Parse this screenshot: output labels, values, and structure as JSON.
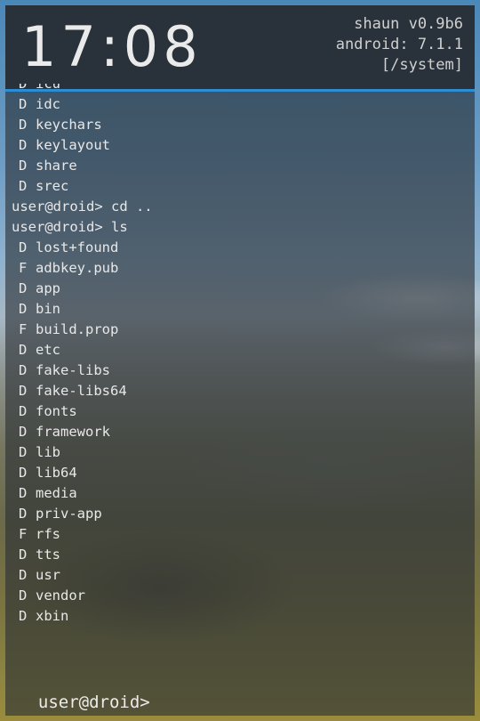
{
  "header": {
    "clock": "17:08",
    "launcher": "shaun v0.9b6",
    "android": "android: 7.1.1",
    "cwd": "[/system]"
  },
  "output": [
    {
      "kind": "entry",
      "type": "D",
      "name": "icu"
    },
    {
      "kind": "entry",
      "type": "D",
      "name": "idc"
    },
    {
      "kind": "entry",
      "type": "D",
      "name": "keychars"
    },
    {
      "kind": "entry",
      "type": "D",
      "name": "keylayout"
    },
    {
      "kind": "entry",
      "type": "D",
      "name": "share"
    },
    {
      "kind": "entry",
      "type": "D",
      "name": "srec"
    },
    {
      "kind": "command",
      "text": "user@droid> cd .."
    },
    {
      "kind": "command",
      "text": "user@droid> ls"
    },
    {
      "kind": "entry",
      "type": "D",
      "name": "lost+found"
    },
    {
      "kind": "entry",
      "type": "F",
      "name": "adbkey.pub"
    },
    {
      "kind": "entry",
      "type": "D",
      "name": "app"
    },
    {
      "kind": "entry",
      "type": "D",
      "name": "bin"
    },
    {
      "kind": "entry",
      "type": "F",
      "name": "build.prop"
    },
    {
      "kind": "entry",
      "type": "D",
      "name": "etc"
    },
    {
      "kind": "entry",
      "type": "D",
      "name": "fake-libs"
    },
    {
      "kind": "entry",
      "type": "D",
      "name": "fake-libs64"
    },
    {
      "kind": "entry",
      "type": "D",
      "name": "fonts"
    },
    {
      "kind": "entry",
      "type": "D",
      "name": "framework"
    },
    {
      "kind": "entry",
      "type": "D",
      "name": "lib"
    },
    {
      "kind": "entry",
      "type": "D",
      "name": "lib64"
    },
    {
      "kind": "entry",
      "type": "D",
      "name": "media"
    },
    {
      "kind": "entry",
      "type": "D",
      "name": "priv-app"
    },
    {
      "kind": "entry",
      "type": "F",
      "name": "rfs"
    },
    {
      "kind": "entry",
      "type": "D",
      "name": "tts"
    },
    {
      "kind": "entry",
      "type": "D",
      "name": "usr"
    },
    {
      "kind": "entry",
      "type": "D",
      "name": "vendor"
    },
    {
      "kind": "entry",
      "type": "D",
      "name": "xbin"
    }
  ],
  "prompt": "user@droid>",
  "colors": {
    "accent": "#2c8dd4",
    "header_bg": "#282f37",
    "text": "#e8e8e8"
  }
}
